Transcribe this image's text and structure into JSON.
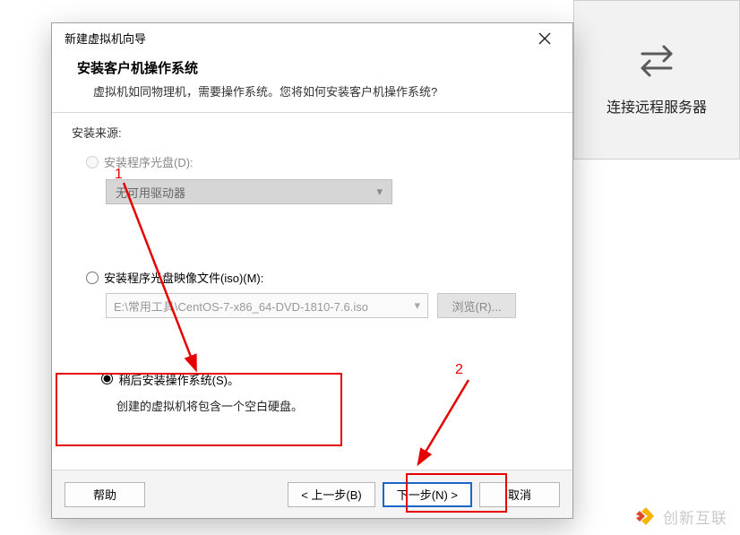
{
  "side_panel": {
    "label": "连接远程服务器"
  },
  "dialog": {
    "title": "新建虚拟机向导",
    "header": {
      "title": "安装客户机操作系统",
      "subtitle": "虚拟机如同物理机，需要操作系统。您将如何安装客户机操作系统?"
    },
    "body": {
      "source_label": "安装来源:",
      "opt_disc": {
        "label": "安装程序光盘(D):",
        "combo_value": "无可用驱动器"
      },
      "opt_iso": {
        "label": "安装程序光盘映像文件(iso)(M):",
        "path": "E:\\常用工具\\CentOS-7-x86_64-DVD-1810-7.6.iso",
        "browse": "浏览(R)..."
      },
      "opt_later": {
        "label": "稍后安装操作系统(S)。",
        "desc": "创建的虚拟机将包含一个空白硬盘。"
      }
    },
    "footer": {
      "help": "帮助",
      "back": "< 上一步(B)",
      "next": "下一步(N) >",
      "cancel": "取消"
    }
  },
  "annotations": {
    "num1": "1",
    "num2": "2"
  },
  "logo": {
    "text": "创新互联"
  }
}
